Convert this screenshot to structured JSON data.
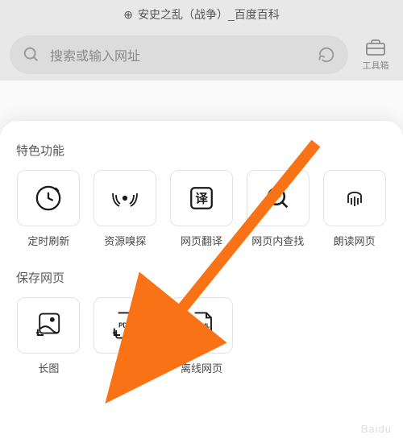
{
  "header": {
    "page_title": "安史之乱（战争）_百度百科"
  },
  "search": {
    "placeholder": "搜索或输入网址"
  },
  "toolbox": {
    "label": "工具箱"
  },
  "sheet": {
    "section_features": {
      "title": "特色功能",
      "items": [
        {
          "label": "定时刷新",
          "icon": "clock-icon"
        },
        {
          "label": "资源嗅探",
          "icon": "radar-icon"
        },
        {
          "label": "网页翻译",
          "icon": "translate-icon"
        },
        {
          "label": "网页内查找",
          "icon": "find-icon"
        },
        {
          "label": "朗读网页",
          "icon": "audio-icon"
        }
      ]
    },
    "section_save": {
      "title": "保存网页",
      "items": [
        {
          "label": "长图",
          "icon": "longimage-icon"
        },
        {
          "label": "PDF",
          "icon": "pdf-icon"
        },
        {
          "label": "离线网页",
          "icon": "html-icon"
        }
      ]
    }
  },
  "arrow": {
    "color": "#f97316"
  },
  "watermark": "Baidu"
}
